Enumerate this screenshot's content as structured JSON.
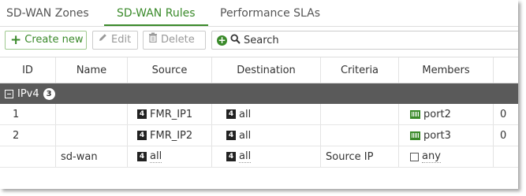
{
  "tabs": {
    "zones": "SD-WAN Zones",
    "rules": "SD-WAN Rules",
    "slas": "Performance SLAs"
  },
  "toolbar": {
    "create_label": "Create new",
    "edit_label": "Edit",
    "delete_label": "Delete",
    "search_label": "Search"
  },
  "table": {
    "headers": [
      "ID",
      "Name",
      "Source",
      "Destination",
      "Criteria",
      "Members"
    ],
    "group": {
      "label": "IPv4",
      "count": "3"
    },
    "rows": [
      {
        "id": "1",
        "name": "",
        "source": "FMR_IP1",
        "destination": "all",
        "criteria": "",
        "members": "port2",
        "extra": "0"
      },
      {
        "id": "2",
        "name": "",
        "source": "FMR_IP2",
        "destination": "all",
        "criteria": "",
        "members": "port3",
        "extra": "0"
      },
      {
        "id": "",
        "name": "sd-wan",
        "source": "all",
        "destination": "all",
        "criteria": "Source IP",
        "members": "any",
        "extra": ""
      }
    ]
  },
  "colors": {
    "accent": "#3a8a2a",
    "group_bg": "#5a5a5a"
  }
}
